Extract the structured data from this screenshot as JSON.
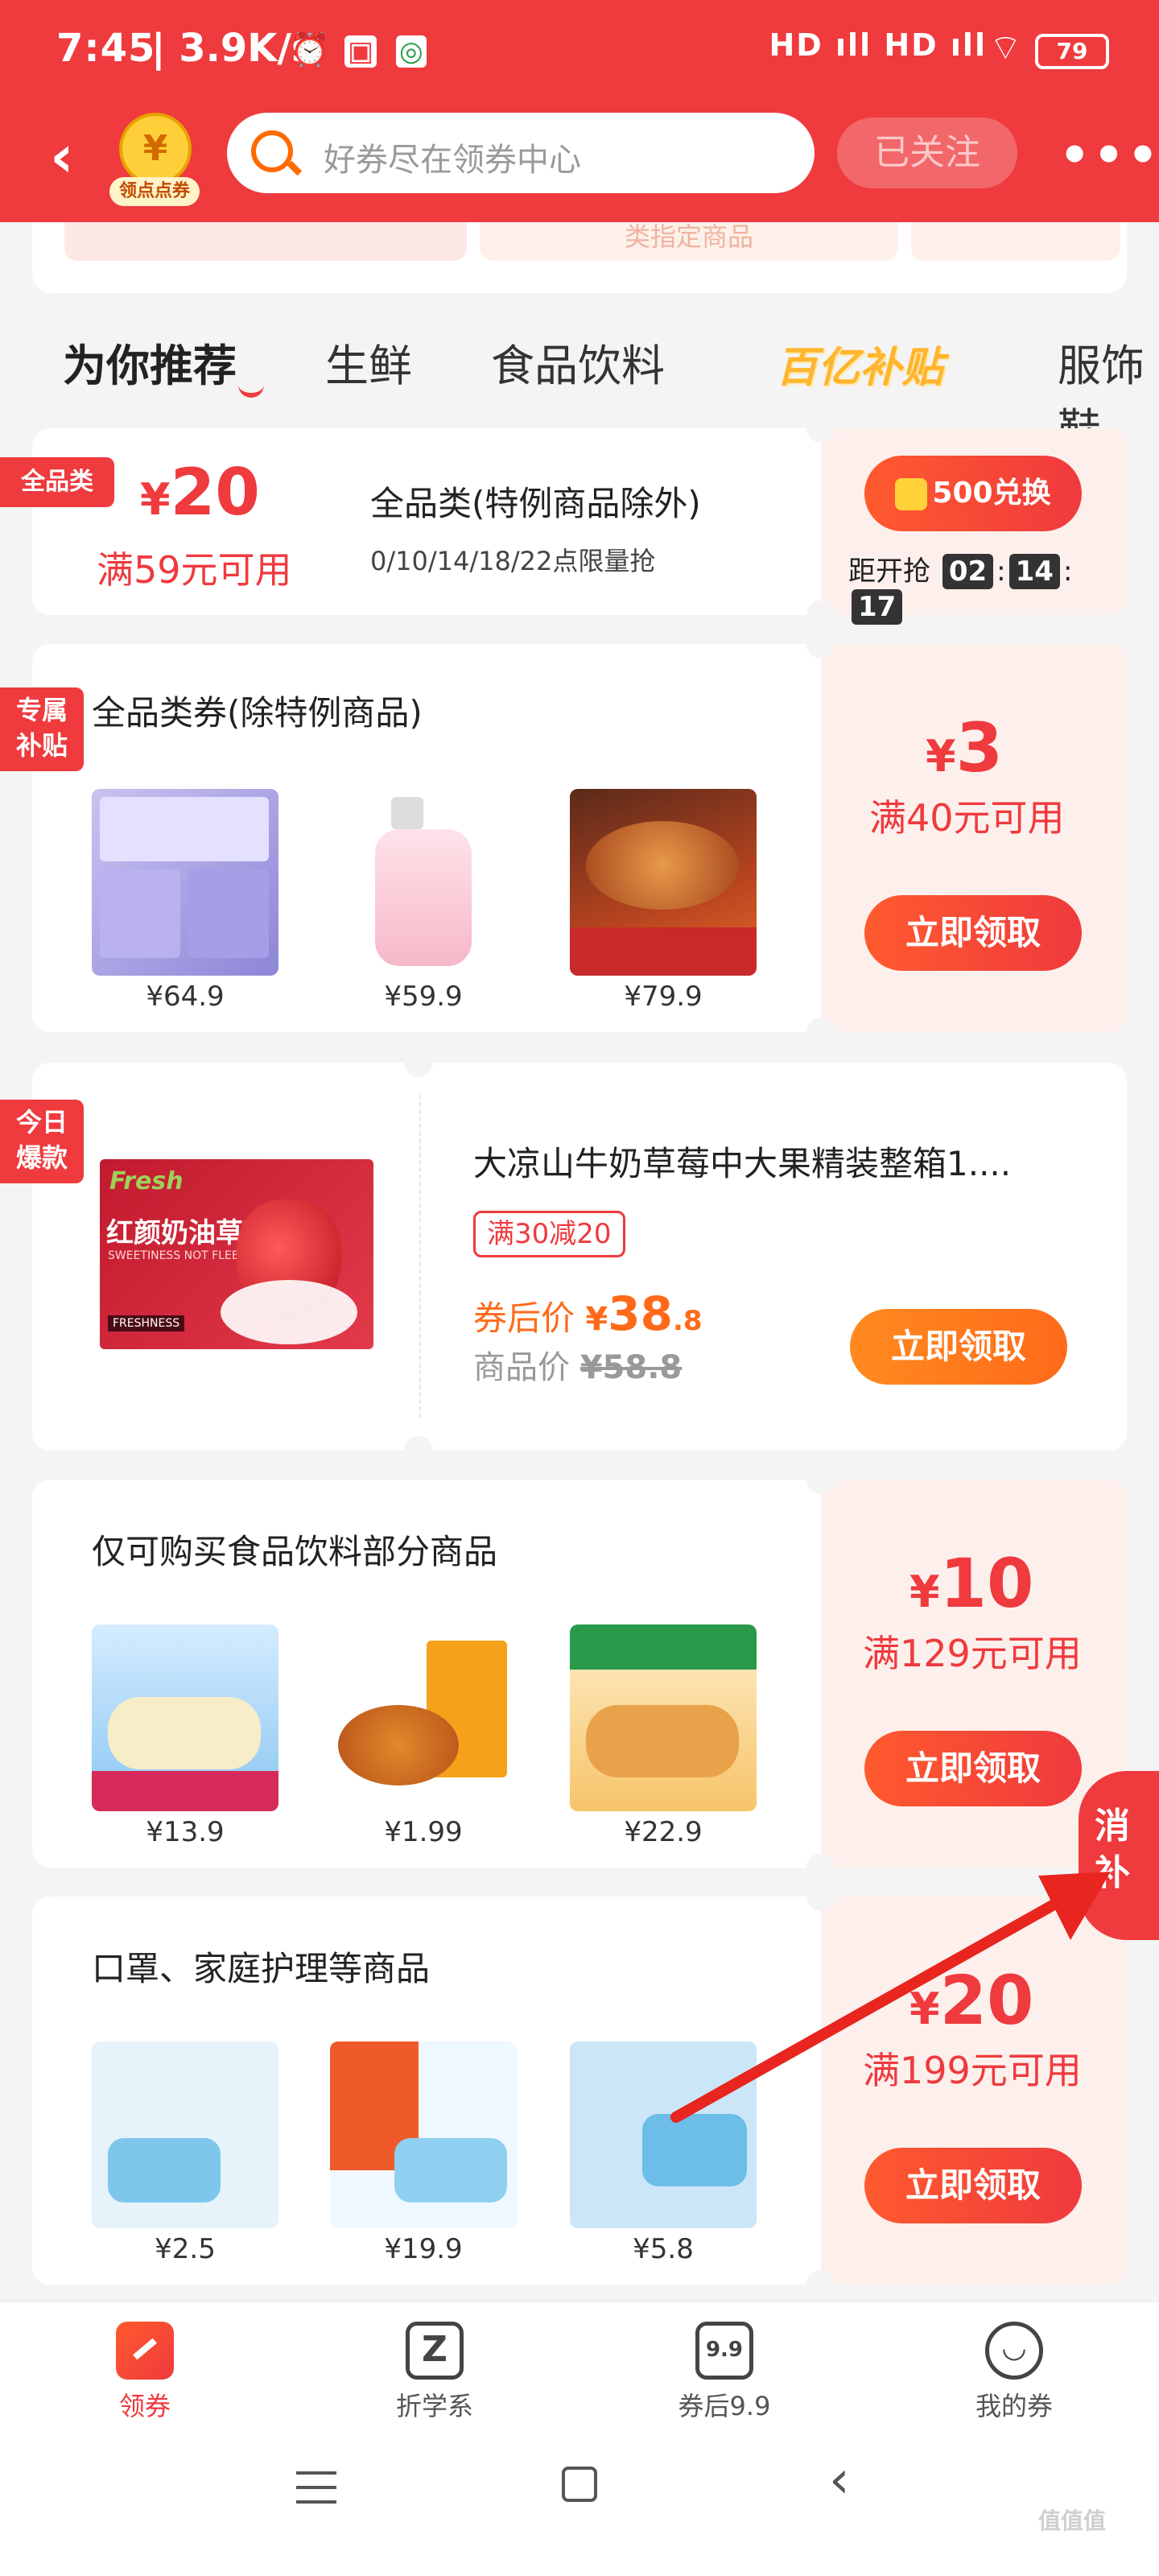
{
  "status_bar": {
    "time": "7:45",
    "speed": "3.9K/s",
    "signal": "HD ıll HD ıll",
    "battery": "79"
  },
  "header": {
    "coin_label": "领点点券",
    "coin_symbol": "¥",
    "search_placeholder": "好券尽在领券中心",
    "follow_label": "已关注"
  },
  "banner": {
    "middle_text": "类指定商品"
  },
  "tabs": [
    {
      "label": "为你推荐"
    },
    {
      "label": "生鲜"
    },
    {
      "label": "食品饮料"
    },
    {
      "label": "百亿补贴"
    },
    {
      "label": "服饰鞋"
    }
  ],
  "coupon1": {
    "tag": "全品类",
    "amount": "20",
    "yen": "¥",
    "condition": "满59元可用",
    "title": "全品类(特例商品除外)",
    "subtitle": "0/10/14/18/22点限量抢",
    "exchange_label": "500兑换",
    "countdown_label": "距开抢",
    "countdown": [
      "02",
      "14",
      "17"
    ]
  },
  "coupon2": {
    "tag": "专属\n补贴",
    "tag_line1": "专属",
    "tag_line2": "补贴",
    "title": "全品类券(除特例商品)",
    "yen": "¥",
    "amount": "3",
    "condition": "满40元可用",
    "button": "立即领取",
    "products": [
      {
        "price": "¥64.9"
      },
      {
        "price": "¥59.9"
      },
      {
        "price": "¥79.9"
      }
    ]
  },
  "deal": {
    "tag_line1": "今日",
    "tag_line2": "爆款",
    "title": "大凉山牛奶草莓中大果精装整箱1....",
    "badge": "满30减20",
    "after_label": "券后价",
    "after_yen": "¥",
    "after_int": "38",
    "after_dec": ".8",
    "orig_label": "商品价",
    "orig_price": "¥58.8",
    "button": "立即领取",
    "img_brand": "Fresh",
    "img_text": "红颜奶油草莓",
    "img_sub": "SWEETINESS NOT FLEETING",
    "img_foot": "FRESHNESS"
  },
  "coupon3": {
    "title": "仅可购买食品饮料部分商品",
    "yen": "¥",
    "amount": "10",
    "condition": "满129元可用",
    "button": "立即领取",
    "products": [
      {
        "price": "¥13.9"
      },
      {
        "price": "¥1.99"
      },
      {
        "price": "¥22.9"
      }
    ]
  },
  "coupon4": {
    "title": "口罩、家庭护理等商品",
    "yen": "¥",
    "amount": "20",
    "condition": "满199元可用",
    "button": "立即领取",
    "products": [
      {
        "price": "¥2.5"
      },
      {
        "price": "¥19.9"
      },
      {
        "price": "¥5.8"
      }
    ]
  },
  "float_badge": {
    "line1": "消",
    "line2": "补"
  },
  "bottom_nav": [
    {
      "label": "领券"
    },
    {
      "label": "折学系"
    },
    {
      "label": "券后9.9",
      "icon_text": "9.9"
    },
    {
      "label": "我的券"
    }
  ],
  "watermark": "值值值",
  "colors": {
    "brand_red": "#ef3a3e",
    "orange": "#ff7a1a",
    "countdown_bg": "#333333"
  }
}
